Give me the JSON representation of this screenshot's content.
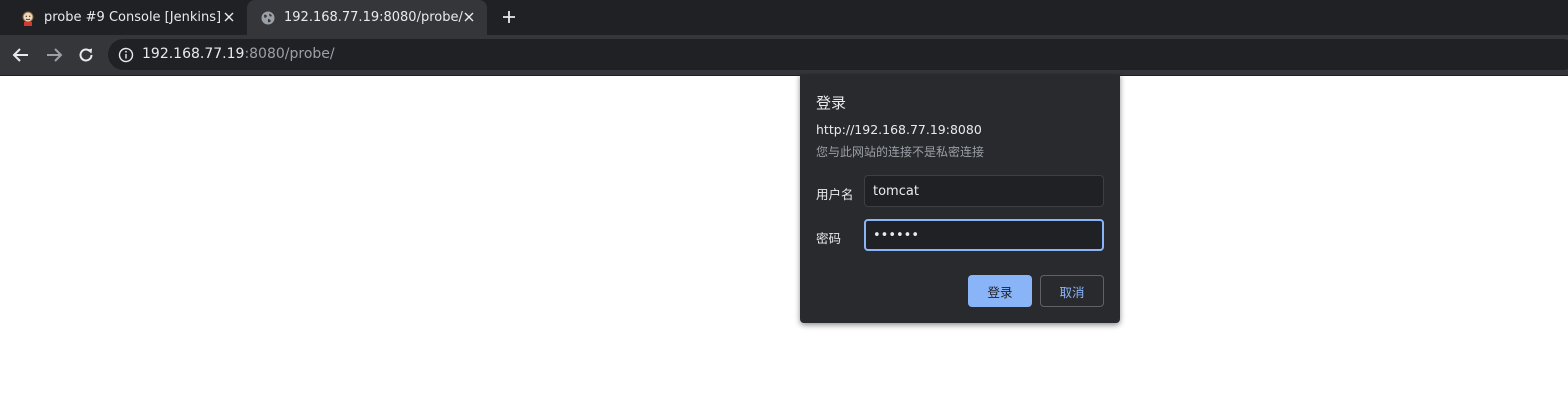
{
  "browser": {
    "tabs": [
      {
        "title": "probe #9 Console [Jenkins]",
        "favicon": "jenkins-icon",
        "active": false
      },
      {
        "title": "192.168.77.19:8080/probe/",
        "favicon": "globe-icon",
        "active": true
      }
    ],
    "address_bar": {
      "host": "192.168.77.19",
      "rest": ":8080/probe/"
    }
  },
  "login_dialog": {
    "title": "登录",
    "origin": "http://192.168.77.19:8080",
    "warning": "您与此网站的连接不是私密连接",
    "username_label": "用户名",
    "username_value": "tomcat",
    "password_label": "密码",
    "password_value": "tomcat",
    "sign_in_label": "登录",
    "cancel_label": "取消"
  },
  "colors": {
    "accent": "#8ab4f8",
    "dialog_bg": "#292a2d",
    "toolbar_bg": "#35363a",
    "tabstrip_bg": "#202124"
  }
}
